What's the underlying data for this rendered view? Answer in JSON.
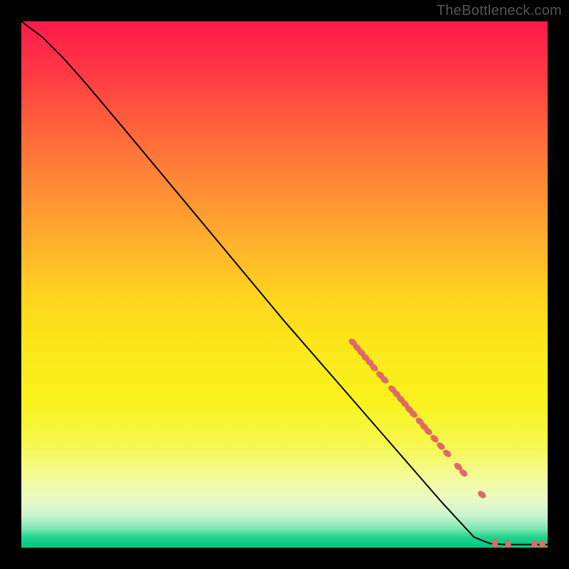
{
  "watermark": "TheBottleneck.com",
  "chart_data": {
    "type": "line",
    "xlim": [
      0,
      100
    ],
    "ylim": [
      0,
      100
    ],
    "curve": [
      {
        "x": 0,
        "y": 100
      },
      {
        "x": 4,
        "y": 97
      },
      {
        "x": 8,
        "y": 93
      },
      {
        "x": 12,
        "y": 88.5
      },
      {
        "x": 20,
        "y": 79
      },
      {
        "x": 30,
        "y": 67
      },
      {
        "x": 40,
        "y": 55
      },
      {
        "x": 50,
        "y": 43
      },
      {
        "x": 60,
        "y": 31.5
      },
      {
        "x": 70,
        "y": 20
      },
      {
        "x": 80,
        "y": 8.5
      },
      {
        "x": 86,
        "y": 2.0
      },
      {
        "x": 89,
        "y": 0.8
      },
      {
        "x": 92,
        "y": 0.6
      },
      {
        "x": 100,
        "y": 0.6
      }
    ],
    "markers": [
      {
        "x": 63.0,
        "y": 39.0
      },
      {
        "x": 63.8,
        "y": 38.0
      },
      {
        "x": 64.6,
        "y": 37.1
      },
      {
        "x": 65.4,
        "y": 36.1
      },
      {
        "x": 66.2,
        "y": 35.2
      },
      {
        "x": 67.0,
        "y": 34.2
      },
      {
        "x": 68.2,
        "y": 32.8
      },
      {
        "x": 69.0,
        "y": 31.9
      },
      {
        "x": 70.5,
        "y": 30.1
      },
      {
        "x": 71.3,
        "y": 29.2
      },
      {
        "x": 72.1,
        "y": 28.2
      },
      {
        "x": 72.9,
        "y": 27.3
      },
      {
        "x": 73.7,
        "y": 26.3
      },
      {
        "x": 74.5,
        "y": 25.4
      },
      {
        "x": 75.7,
        "y": 24.0
      },
      {
        "x": 76.5,
        "y": 23.0
      },
      {
        "x": 77.3,
        "y": 22.1
      },
      {
        "x": 78.5,
        "y": 20.7
      },
      {
        "x": 79.7,
        "y": 19.3
      },
      {
        "x": 80.9,
        "y": 17.9
      },
      {
        "x": 83.0,
        "y": 15.4
      },
      {
        "x": 84.0,
        "y": 14.2
      },
      {
        "x": 87.5,
        "y": 10.1
      },
      {
        "x": 90.0,
        "y": 0.8
      },
      {
        "x": 92.5,
        "y": 0.6
      },
      {
        "x": 97.5,
        "y": 0.6
      },
      {
        "x": 99.0,
        "y": 0.6
      }
    ],
    "marker_rx": 4,
    "marker_ry": 6
  }
}
